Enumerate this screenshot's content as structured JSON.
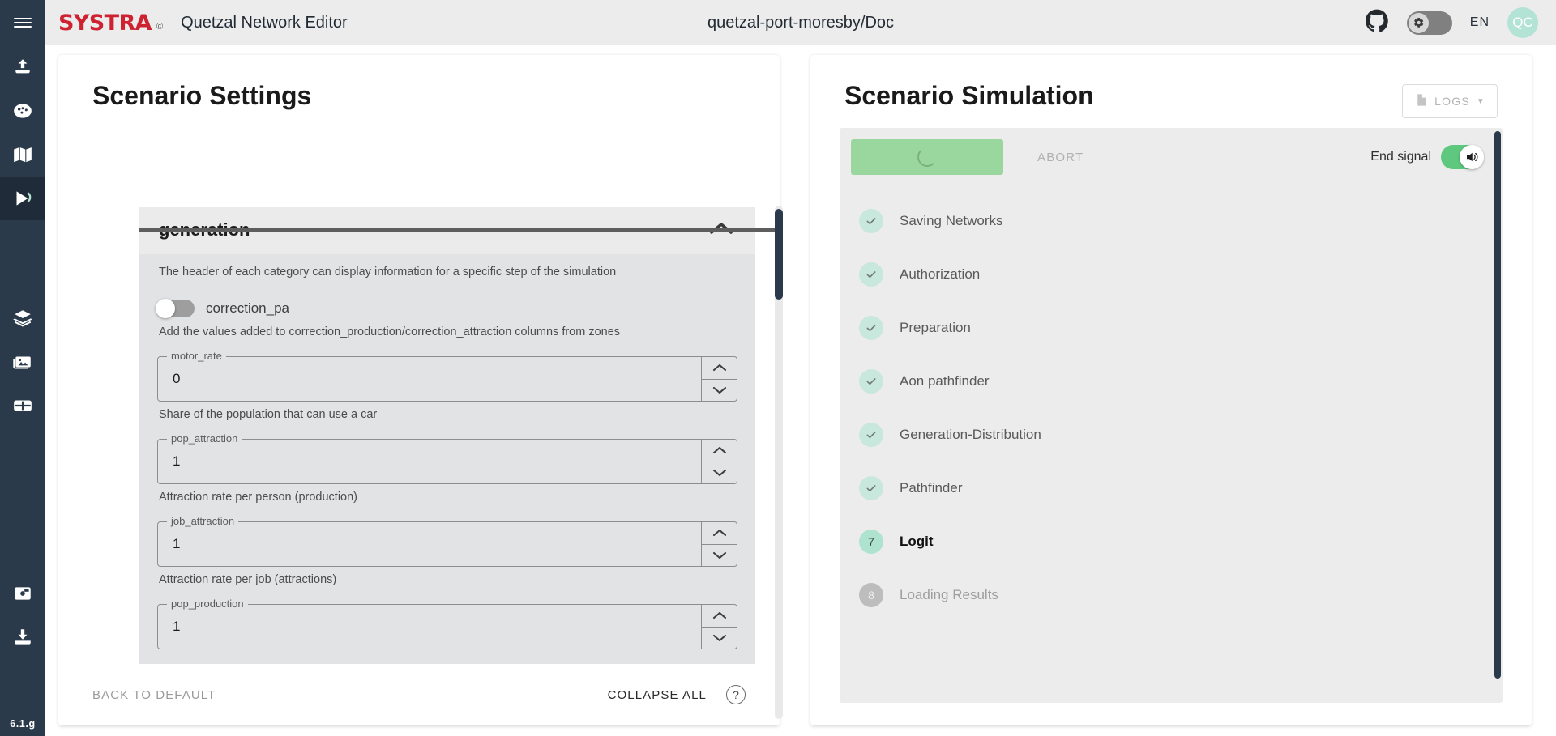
{
  "rail": {
    "menu_label": "menu",
    "items": [
      {
        "name": "upload-icon",
        "label": "Upload"
      },
      {
        "name": "palette-icon",
        "label": "Styles"
      },
      {
        "name": "map-icon",
        "label": "Map"
      },
      {
        "name": "run-icon",
        "label": "Run",
        "active": true
      },
      {
        "name": "layers-icon",
        "label": "Layers"
      },
      {
        "name": "image-icon",
        "label": "Images"
      },
      {
        "name": "table-icon",
        "label": "Tables"
      },
      {
        "name": "save-icon",
        "label": "Save"
      },
      {
        "name": "download-icon",
        "label": "Download"
      }
    ],
    "version": "6.1.g"
  },
  "topbar": {
    "brand": "SYSTRA",
    "brand_mark": "©",
    "app_title": "Quetzal Network Editor",
    "document_title": "quetzal-port-moresby/Doc",
    "github_icon": "github-icon",
    "settings_toggle_icon": "gear-icon",
    "language": "EN",
    "avatar_initials": "QC"
  },
  "left_panel": {
    "title": "Scenario Settings",
    "accordion": {
      "title": "generation",
      "collapse_icon": "chevron-up-icon",
      "hint": "The header of each category can display information for a specific step of the simulation"
    },
    "toggle": {
      "label": "correction_pa",
      "state": "off",
      "description": "Add the values added to correction_production/correction_attraction columns from zones"
    },
    "fields": [
      {
        "label": "motor_rate",
        "value": "0",
        "description": "Share of the population that can use a car"
      },
      {
        "label": "pop_attraction",
        "value": "1",
        "description": "Attraction rate per person (production)"
      },
      {
        "label": "job_attraction",
        "value": "1",
        "description": "Attraction rate per job (attractions)"
      },
      {
        "label": "pop_production",
        "value": "1",
        "description": ""
      }
    ],
    "footer": {
      "back_to_default": "BACK TO DEFAULT",
      "collapse_all": "COLLAPSE ALL",
      "help_icon": "help-circle-icon",
      "help_glyph": "?"
    }
  },
  "right_panel": {
    "title": "Scenario Simulation",
    "logs_button": {
      "label": "LOGS",
      "icon": "document-icon",
      "caret": "▼"
    },
    "controls": {
      "run_button_state": "loading",
      "run_button_icon": "spinner-icon",
      "abort_label": "ABORT",
      "end_signal_label": "End signal",
      "sound_icon": "speaker-on-icon",
      "sound_state": "on"
    },
    "steps": [
      {
        "index": "1",
        "label": "Saving Networks",
        "state": "done"
      },
      {
        "index": "2",
        "label": "Authorization",
        "state": "done"
      },
      {
        "index": "3",
        "label": "Preparation",
        "state": "done"
      },
      {
        "index": "4",
        "label": "Aon pathfinder",
        "state": "done"
      },
      {
        "index": "5",
        "label": "Generation-Distribution",
        "state": "done"
      },
      {
        "index": "6",
        "label": "Pathfinder",
        "state": "done"
      },
      {
        "index": "7",
        "label": "Logit",
        "state": "active"
      },
      {
        "index": "8",
        "label": "Loading Results",
        "state": "pending"
      }
    ]
  },
  "colors": {
    "rail_bg": "#2b3a4a",
    "brand_red": "#cf2231",
    "accent_green": "#9ad79f",
    "step_done": "#c9e8dd",
    "step_active": "#aee3d0",
    "step_pending": "#bdbdbd",
    "toggle_on": "#5fc87f"
  }
}
